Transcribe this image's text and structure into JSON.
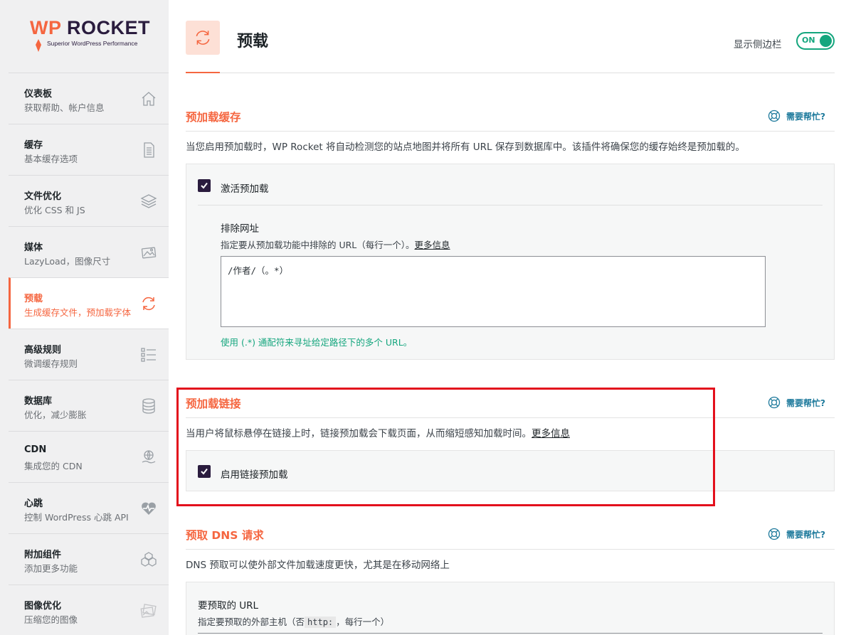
{
  "brand": {
    "logo_wp": "WP",
    "logo_rocket": "ROCKET",
    "tagline": "Superior WordPress Performance"
  },
  "sidebar": {
    "items": [
      {
        "title": "仪表板",
        "desc": "获取帮助、帐户信息",
        "icon": "home-icon"
      },
      {
        "title": "缓存",
        "desc": "基本缓存选项",
        "icon": "file-icon"
      },
      {
        "title": "文件优化",
        "desc": "优化 CSS 和 JS",
        "icon": "layers-icon"
      },
      {
        "title": "媒体",
        "desc": "LazyLoad，图像尺寸",
        "icon": "image-icon"
      },
      {
        "title": "预载",
        "desc": "生成缓存文件，预加载字体",
        "icon": "refresh-icon"
      },
      {
        "title": "高级规则",
        "desc": "微调缓存规则",
        "icon": "list-icon"
      },
      {
        "title": "数据库",
        "desc": "优化，减少膨胀",
        "icon": "database-icon"
      },
      {
        "title": "CDN",
        "desc": "集成您的 CDN",
        "icon": "globe-hand-icon"
      },
      {
        "title": "心跳",
        "desc": "控制 WordPress 心跳 API",
        "icon": "heartbeat-icon"
      },
      {
        "title": "附加组件",
        "desc": "添加更多功能",
        "icon": "cubes-icon"
      },
      {
        "title": "图像优化",
        "desc": "压缩您的图像",
        "icon": "images-icon"
      }
    ]
  },
  "header": {
    "title": "预载",
    "sidebar_toggle_label": "显示侧边栏",
    "toggle_state": "ON"
  },
  "help_label": "需要帮忙?",
  "sections": {
    "preload_cache": {
      "title": "预加载缓存",
      "desc": "当您启用预加载时，WP Rocket 将自动检测您的站点地图并将所有 URL 保存到数据库中。该插件将确保您的缓存始终是预加载的。",
      "checkbox_label": "激活预加载",
      "exclude_title": "排除网址",
      "exclude_desc": "指定要从预加载功能中排除的 URL（每行一个）。",
      "more_info": "更多信息",
      "textarea_value": "/作者/（。*）",
      "hint": "使用 (.*) 通配符来寻址给定路径下的多个 URL。"
    },
    "preload_links": {
      "title": "预加载链接",
      "desc": "当用户将鼠标悬停在链接上时，链接预加载会下载页面，从而缩短感知加载时间。",
      "more_info": "更多信息",
      "checkbox_label": "启用链接预加载"
    },
    "dns_prefetch": {
      "title": "预取 DNS 请求",
      "desc": "DNS 预取可以使外部文件加载速度更快，尤其是在移动网络上",
      "field_title": "要预取的 URL",
      "field_desc_pre": "指定要预取的外部主机（否",
      "field_code": "http:",
      "field_desc_post": "，每行一个）"
    }
  },
  "colors": {
    "accent": "#f56640",
    "brand_dark": "#2a1c3e",
    "success": "#15a67e",
    "link": "#1e7a9c",
    "highlight": "#e3101c"
  }
}
